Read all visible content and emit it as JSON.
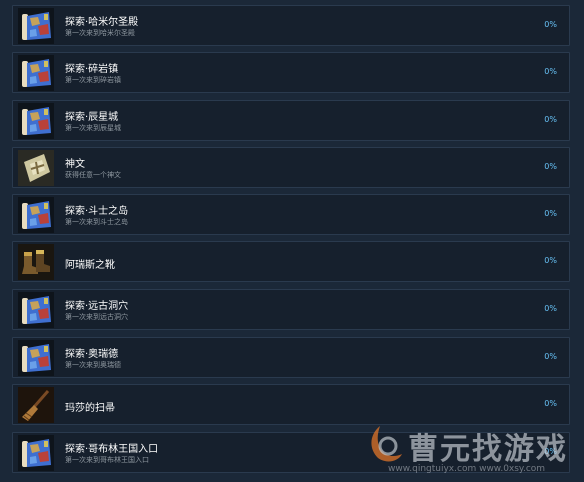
{
  "achievements": [
    {
      "title": "探索·哈米尔圣殿",
      "desc": "第一次来到哈米尔圣殿",
      "percent": "0%",
      "icon": "map-scroll-icon"
    },
    {
      "title": "探索·碎岩镇",
      "desc": "第一次来到碎岩镇",
      "percent": "0%",
      "icon": "map-scroll-icon"
    },
    {
      "title": "探索·辰星城",
      "desc": "第一次来到辰星城",
      "percent": "0%",
      "icon": "map-scroll-icon"
    },
    {
      "title": "神文",
      "desc": "获得任意一个神文",
      "percent": "0%",
      "icon": "rune-tablet-icon"
    },
    {
      "title": "探索·斗士之岛",
      "desc": "第一次来到斗士之岛",
      "percent": "0%",
      "icon": "map-scroll-icon"
    },
    {
      "title": "阿瑞斯之靴",
      "desc": "",
      "percent": "0%",
      "icon": "boots-icon"
    },
    {
      "title": "探索·远古洞穴",
      "desc": "第一次来到远古洞穴",
      "percent": "0%",
      "icon": "map-scroll-icon"
    },
    {
      "title": "探索·奥瑞德",
      "desc": "第一次来到奥瑞德",
      "percent": "0%",
      "icon": "map-scroll-icon"
    },
    {
      "title": "玛莎的扫帚",
      "desc": "",
      "percent": "0%",
      "icon": "broom-icon"
    },
    {
      "title": "探索·哥布林王国入口",
      "desc": "第一次来到哥布林王国入口",
      "percent": "0%",
      "icon": "map-scroll-icon"
    }
  ],
  "watermark": {
    "name": "曹元找游戏",
    "url": "www.qingtuiyx.com    www.0xsy.com"
  },
  "colors": {
    "background": "#1b2838",
    "row": "#16202d",
    "percent": "#67c1f5"
  }
}
